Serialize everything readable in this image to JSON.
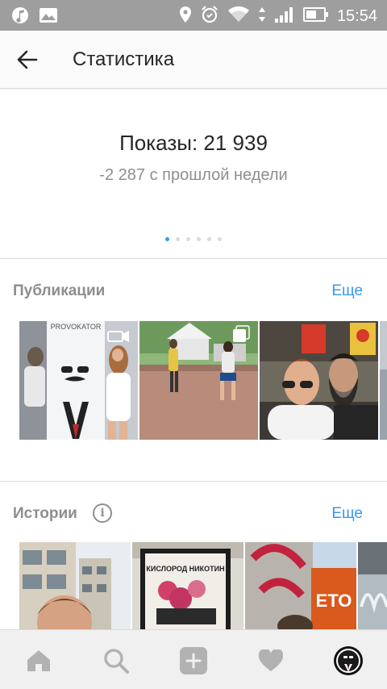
{
  "status_bar": {
    "time": "15:54",
    "left_icons": [
      "music-note-icon",
      "image-icon"
    ],
    "right_icons": [
      "location-icon",
      "alarm-icon",
      "wifi-icon",
      "data-arrows-icon",
      "signal-icon",
      "battery-icon"
    ]
  },
  "header": {
    "back_icon": "back-arrow-icon",
    "title": "Статистика"
  },
  "impressions": {
    "value_text": "Показы: 21 939",
    "change_text": "-2 287 с прошлой недели",
    "pager_count": 6,
    "pager_active": 0
  },
  "publications": {
    "title": "Публикации",
    "more": "Еще",
    "posts": [
      {
        "type": "video",
        "overlay_text": "PROVOKATOR"
      },
      {
        "type": "carousel"
      },
      {
        "type": "photo"
      },
      {
        "type": "photo"
      }
    ]
  },
  "stories": {
    "title": "Истории",
    "info_glyph": "i",
    "more": "Еще",
    "items": [
      {
        "overlay_text": ""
      },
      {
        "overlay_text": "КИСЛОРОД НИКОТИН"
      },
      {
        "overlay_text": "ЕТО"
      },
      {
        "overlay_text": ""
      }
    ]
  },
  "bottom_nav": {
    "items": [
      "home-icon",
      "search-icon",
      "add-post-icon",
      "heart-icon",
      "profile-avatar"
    ]
  },
  "colors": {
    "status_bar": "#9e9e9e",
    "accent": "#3897f0",
    "secondary_text": "#8e8e8e",
    "primary_text": "#262626"
  }
}
